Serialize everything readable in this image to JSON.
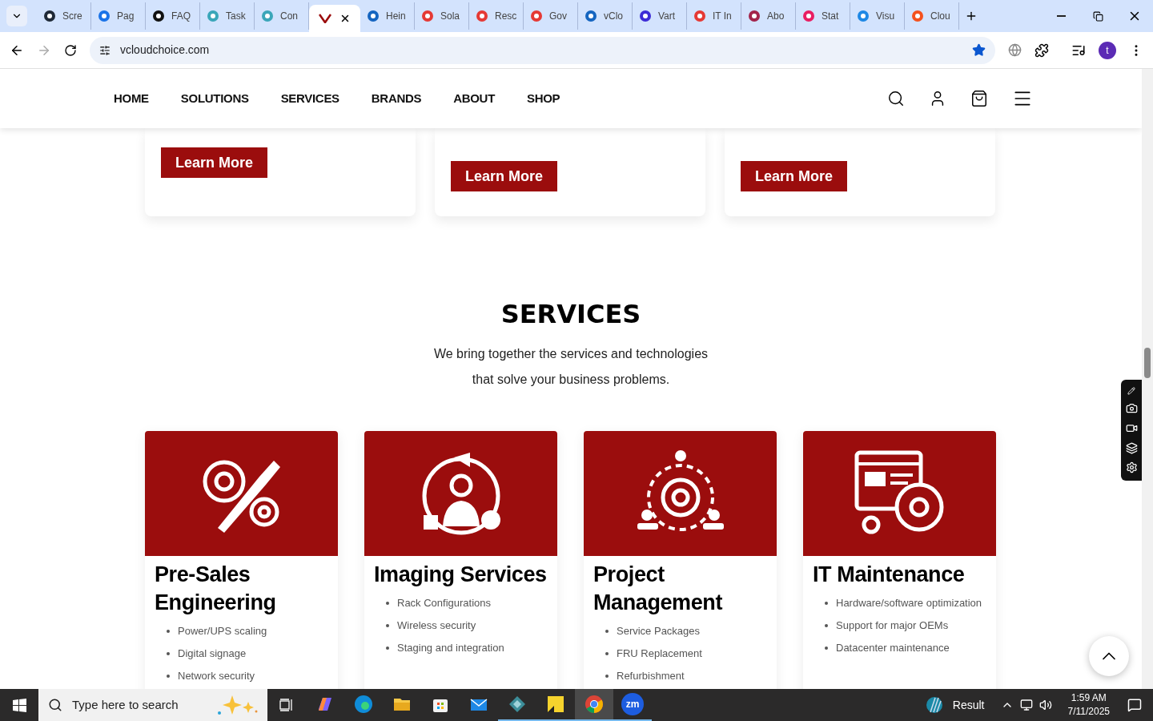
{
  "browser": {
    "tabs": [
      {
        "label": "Scre",
        "selected": false
      },
      {
        "label": "Pag",
        "selected": false
      },
      {
        "label": "FAQ",
        "selected": false
      },
      {
        "label": "Task",
        "selected": false
      },
      {
        "label": "Con",
        "selected": false
      },
      {
        "selected": true
      },
      {
        "label": "Hein",
        "selected": false
      },
      {
        "label": "Sola",
        "selected": false
      },
      {
        "label": "Resc",
        "selected": false
      },
      {
        "label": "Gov",
        "selected": false
      },
      {
        "label": "vClo",
        "selected": false
      },
      {
        "label": "Vart",
        "selected": false
      },
      {
        "label": "IT In",
        "selected": false
      },
      {
        "label": "Abo",
        "selected": false
      },
      {
        "label": "Stat",
        "selected": false
      },
      {
        "label": "Visu",
        "selected": false
      },
      {
        "label": "Clou",
        "selected": false
      }
    ],
    "address": "vcloudchoice.com",
    "bookmarked": true,
    "profile_initial": "t"
  },
  "nav": {
    "items": [
      "HOME",
      "SOLUTIONS",
      "SERVICES",
      "BRANDS",
      "ABOUT",
      "SHOP"
    ]
  },
  "top_cards": [
    {
      "button": "Learn More"
    },
    {
      "button": "Learn More"
    },
    {
      "button": "Learn More"
    }
  ],
  "services": {
    "title": "SERVICES",
    "subtitle": "We bring together the services and technologies that solve your business problems.",
    "cards": [
      {
        "kind": "tools",
        "title": "Pre-Sales Engineering",
        "items": [
          "Power/UPS scaling",
          "Digital signage",
          "Network security"
        ]
      },
      {
        "kind": "person",
        "title": "Imaging Services",
        "items": [
          "Rack Configurations",
          "Wireless security",
          "Staging and integration"
        ]
      },
      {
        "kind": "team",
        "title": "Project Management",
        "items": [
          "Service Packages",
          "FRU Replacement",
          "Refurbishment"
        ]
      },
      {
        "kind": "web",
        "title": "IT Maintenance",
        "items": [
          "Hardware/software optimization",
          "Support for major OEMs",
          "Datacenter maintenance"
        ]
      }
    ]
  },
  "taskbar": {
    "search_placeholder": "Type here to search",
    "apps": [
      {
        "kind": "copilot",
        "running": false,
        "selected": false
      },
      {
        "kind": "edge",
        "running": false,
        "selected": false
      },
      {
        "kind": "folder",
        "running": false,
        "selected": false
      },
      {
        "kind": "store",
        "running": false,
        "selected": false
      },
      {
        "kind": "mail",
        "running": false,
        "selected": false
      },
      {
        "kind": "diamond",
        "running": true,
        "selected": false
      },
      {
        "kind": "note",
        "running": true,
        "selected": false
      },
      {
        "kind": "chrome",
        "running": true,
        "selected": true
      },
      {
        "kind": "zoom",
        "running": true,
        "selected": false,
        "label": "zm"
      }
    ],
    "weather": "Result",
    "time": "1:59 AM",
    "date": "7/11/2025"
  }
}
